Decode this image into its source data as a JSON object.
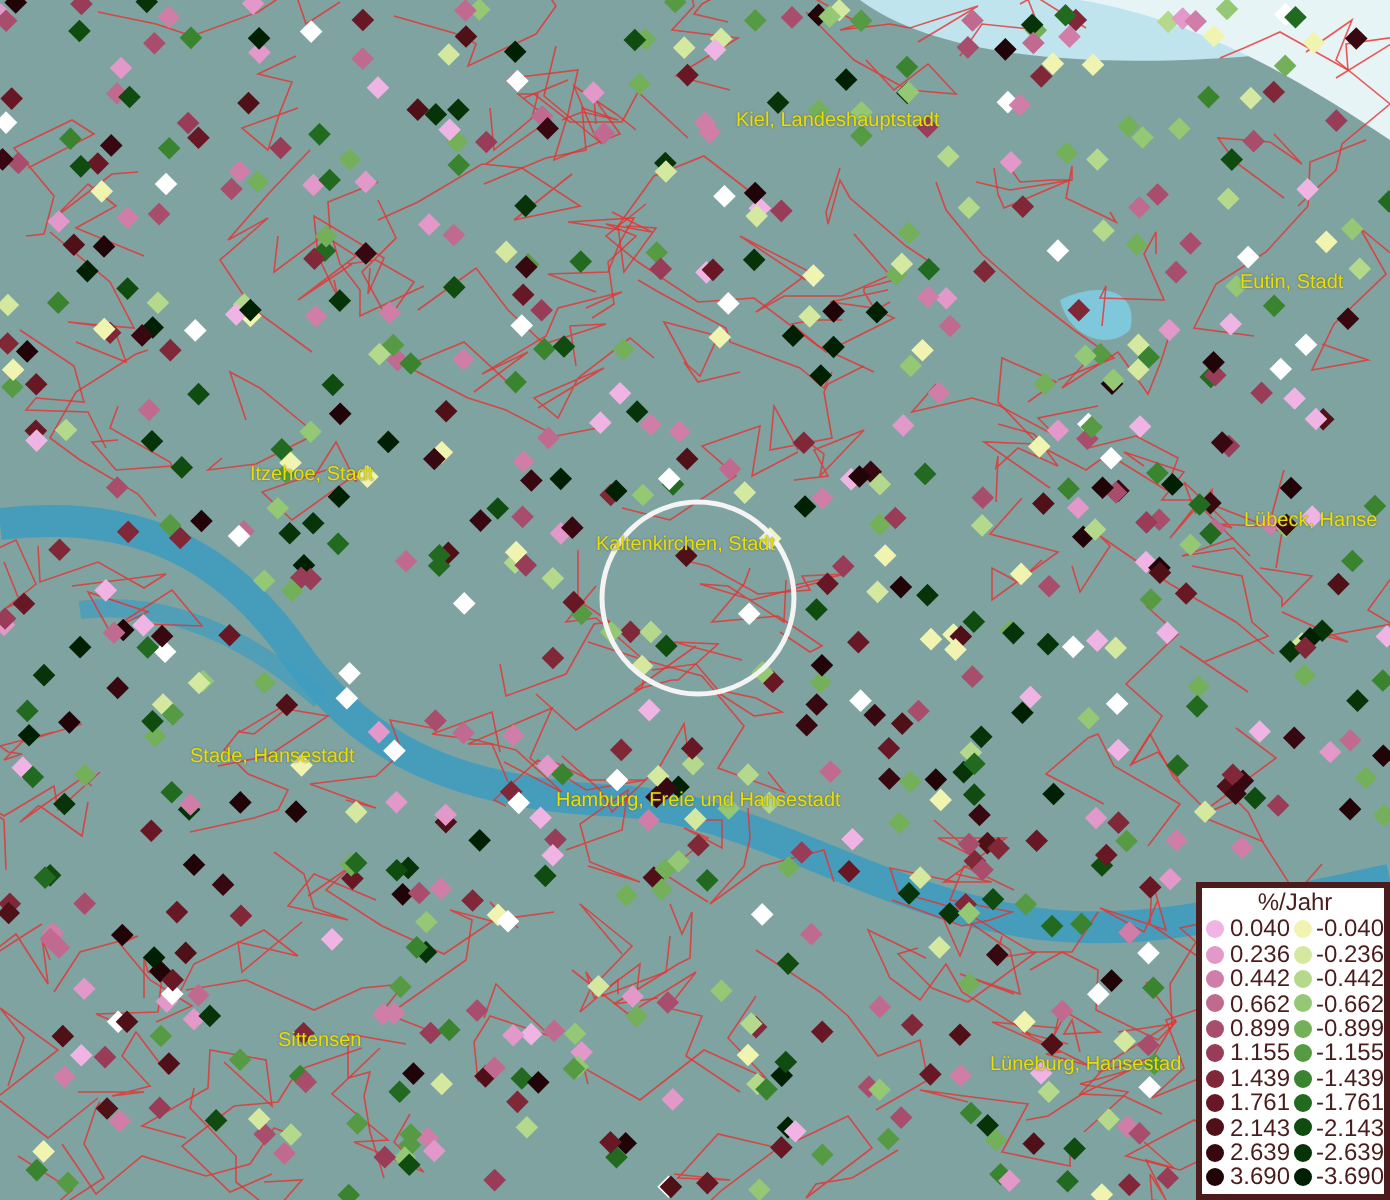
{
  "map": {
    "places": [
      {
        "name": "Kiel, Landeshauptstadt"
      },
      {
        "name": "Eutin, Stadt"
      },
      {
        "name": "Itzehoe, Stadt"
      },
      {
        "name": "Kaltenkirchen, Stadt"
      },
      {
        "name": "Lübeck, Hanse"
      },
      {
        "name": "Stade, Hansestadt"
      },
      {
        "name": "Hamburg, Freie und Hansestadt"
      },
      {
        "name": "Sittensen"
      },
      {
        "name": "Lüneburg, Hansestad"
      }
    ]
  },
  "legend": {
    "title": "%/Jahr",
    "positive": [
      {
        "value": "0.040",
        "color": "#f0b4e4"
      },
      {
        "value": "0.236",
        "color": "#e298c8"
      },
      {
        "value": "0.442",
        "color": "#d07ea8"
      },
      {
        "value": "0.662",
        "color": "#c06a90"
      },
      {
        "value": "0.899",
        "color": "#a84e6c"
      },
      {
        "value": "1.155",
        "color": "#983c58"
      },
      {
        "value": "1.439",
        "color": "#802838"
      },
      {
        "value": "1.761",
        "color": "#681824"
      },
      {
        "value": "2.143",
        "color": "#501018"
      },
      {
        "value": "2.639",
        "color": "#380810"
      },
      {
        "value": "3.690",
        "color": "#200408"
      }
    ],
    "negative": [
      {
        "value": "-0.040",
        "color": "#f0f4b0"
      },
      {
        "value": "-0.236",
        "color": "#d4e8a0"
      },
      {
        "value": "-0.442",
        "color": "#b4d88c"
      },
      {
        "value": "-0.662",
        "color": "#94c874"
      },
      {
        "value": "-0.899",
        "color": "#74b05a"
      },
      {
        "value": "-1.155",
        "color": "#569a44"
      },
      {
        "value": "-1.439",
        "color": "#3a8430"
      },
      {
        "value": "-1.761",
        "color": "#226a20"
      },
      {
        "value": "-2.143",
        "color": "#104c10"
      },
      {
        "value": "-2.639",
        "color": "#063408"
      },
      {
        "value": "-3.690",
        "color": "#002004"
      }
    ]
  }
}
